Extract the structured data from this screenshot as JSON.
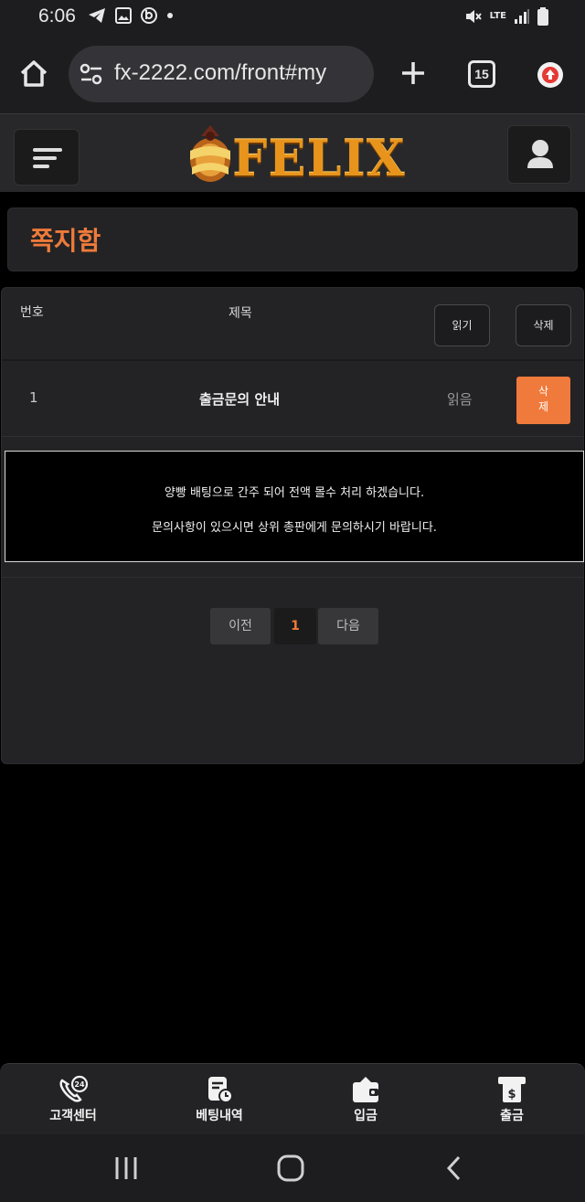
{
  "status_bar": {
    "time": "6:06",
    "network": "LTE"
  },
  "browser": {
    "url": "fx-2222.com/front#my",
    "tab_count": "15"
  },
  "site": {
    "logo_text": "FELIX",
    "accent_color": "#ef7a3a"
  },
  "page": {
    "title": "쪽지함"
  },
  "table": {
    "columns": {
      "no": "번호",
      "title": "제목"
    },
    "read_button": "읽기",
    "delete_button": "삭제",
    "rows": [
      {
        "no": "1",
        "title": "출금문의 안내",
        "status": "읽음",
        "delete_label": "삭\n제"
      }
    ]
  },
  "message": {
    "line1": "양빵 배팅으로 간주 되어 전액 몰수 처리 하겠습니다.",
    "line2": "문의사항이 있으시면 상위 총판에게 문의하시기 바랍니다."
  },
  "pagination": {
    "prev": "이전",
    "current": "1",
    "next": "다음"
  },
  "bottom_nav": {
    "items": [
      {
        "label": "고객센터",
        "icon": "support-24-icon"
      },
      {
        "label": "베팅내역",
        "icon": "betting-history-icon"
      },
      {
        "label": "입금",
        "icon": "deposit-wallet-icon"
      },
      {
        "label": "출금",
        "icon": "withdraw-atm-icon"
      }
    ]
  }
}
